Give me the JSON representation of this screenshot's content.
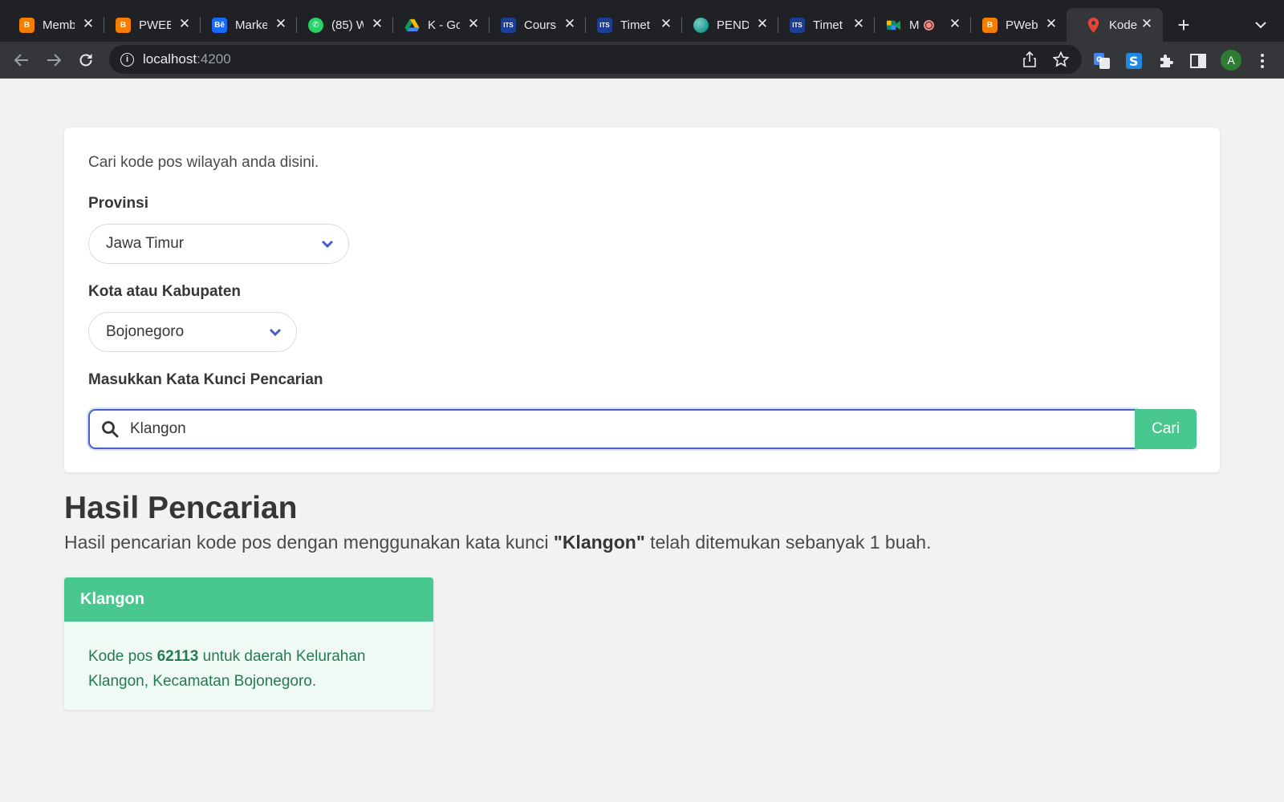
{
  "browser": {
    "tabs": [
      {
        "title": "Memb",
        "favicon": "blogger-icon",
        "color": "#f57d00"
      },
      {
        "title": "PWEB",
        "favicon": "blogger-icon",
        "color": "#f57d00"
      },
      {
        "title": "Marke",
        "favicon": "behance-icon",
        "color": "#1769ff",
        "glyph": "Bē"
      },
      {
        "title": "(85) W",
        "favicon": "whatsapp-icon",
        "color": "#25d366"
      },
      {
        "title": "K - Go",
        "favicon": "google-drive-icon",
        "color": "#0f9d58"
      },
      {
        "title": "Cours",
        "favicon": "its-icon",
        "color": "#1d3f93",
        "glyph": "ITS"
      },
      {
        "title": "Timet",
        "favicon": "its-icon",
        "color": "#1d3f93",
        "glyph": "ITS"
      },
      {
        "title": "PEND",
        "favicon": "globe-icon",
        "color": "#26a69a"
      },
      {
        "title": "Timet",
        "favicon": "its-icon",
        "color": "#1d3f93",
        "glyph": "ITS"
      },
      {
        "title": "M",
        "favicon": "google-meet-icon",
        "color": "#00897b"
      },
      {
        "title": "PWeb",
        "favicon": "blogger-icon",
        "color": "#f57d00"
      },
      {
        "title": "Kode",
        "favicon": "map-pin-icon",
        "color": "#ea4335"
      }
    ],
    "url_host": "localhost",
    "url_port": ":4200",
    "avatar_initial": "A"
  },
  "form": {
    "intro": "Cari kode pos wilayah anda disini.",
    "province_label": "Provinsi",
    "province_value": "Jawa Timur",
    "city_label": "Kota atau Kabupaten",
    "city_value": "Bojonegoro",
    "keyword_label": "Masukkan Kata Kunci Pencarian",
    "keyword_value": "Klangon",
    "search_button": "Cari"
  },
  "results": {
    "title": "Hasil Pencarian",
    "sub_prefix": "Hasil pencarian kode pos dengan menggunakan kata kunci ",
    "sub_keyword": "\"Klangon\"",
    "sub_suffix": " telah ditemukan sebanyak 1 buah.",
    "card_title": "Klangon",
    "card_prefix": "Kode pos ",
    "card_code": "62113",
    "card_suffix": " untuk daerah Kelurahan Klangon, Kecamatan Bojonegoro."
  },
  "colors": {
    "accent_green": "#48c78e",
    "focus_blue": "#485fc7",
    "result_text": "#257953"
  }
}
